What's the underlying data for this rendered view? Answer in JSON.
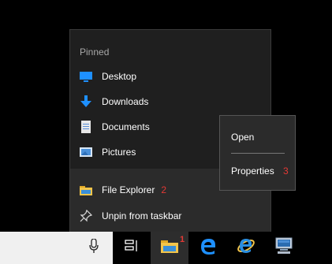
{
  "jumplist": {
    "header": "Pinned",
    "pinned": [
      {
        "label": "Desktop",
        "icon": "desktop-icon"
      },
      {
        "label": "Downloads",
        "icon": "download-arrow-icon"
      },
      {
        "label": "Documents",
        "icon": "document-icon"
      },
      {
        "label": "Pictures",
        "icon": "pictures-icon"
      }
    ],
    "app_label": "File Explorer",
    "app_marker": "2",
    "unpin_label": "Unpin from taskbar"
  },
  "context_menu": {
    "open_label": "Open",
    "properties_label": "Properties",
    "properties_marker": "3"
  },
  "taskbar": {
    "file_explorer_marker": "1",
    "buttons": [
      "microphone-icon",
      "task-view-icon",
      "file-explorer-icon",
      "edge-icon",
      "internet-explorer-icon",
      "remote-desktop-icon"
    ]
  },
  "colors": {
    "accent_blue": "#1e90ff",
    "marker_red": "#e53935",
    "folder_yellow": "#f3c54a"
  }
}
